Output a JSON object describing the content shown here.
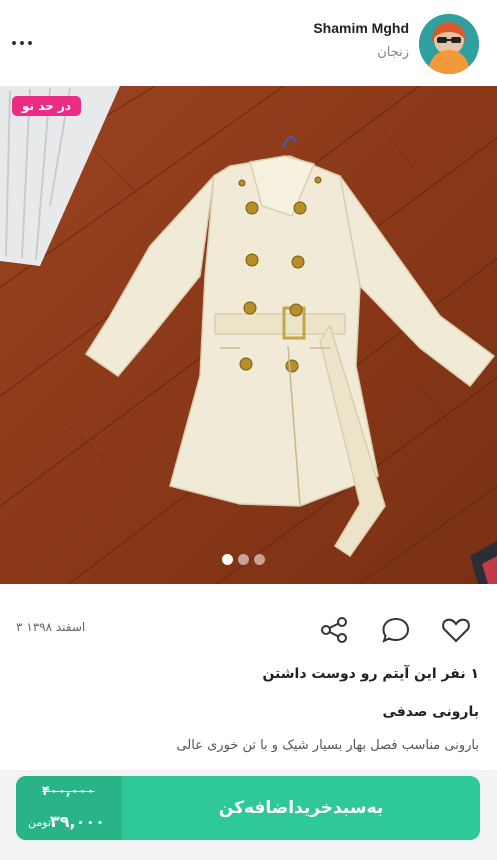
{
  "user": {
    "name": "Shamim Mghd",
    "location": "زنجان"
  },
  "post": {
    "badge": "در حد نو",
    "date": "۳ اسفند ۱۳۹۸",
    "likes_text": "۱ نفر این آیتم رو دوست داشتن",
    "title": "بارونی صدفی",
    "description": "بارونی مناسب فصل بهار بسیار شیک و با تن خوری عالی",
    "image_count": 3,
    "active_image": 1
  },
  "cart": {
    "label": "به‌سبد‌خرید‌اضافه‌کن",
    "old_price": "۴۰۰,۰۰۰",
    "new_price": "۳۹,۰۰۰",
    "currency": "تومن"
  },
  "icons": {
    "menu": "more-dots-icon",
    "like": "heart-icon",
    "comment": "comment-bubble-icon",
    "share": "share-icon"
  },
  "colors": {
    "accent": "#2fc89a",
    "badge": "#ec2b84"
  }
}
